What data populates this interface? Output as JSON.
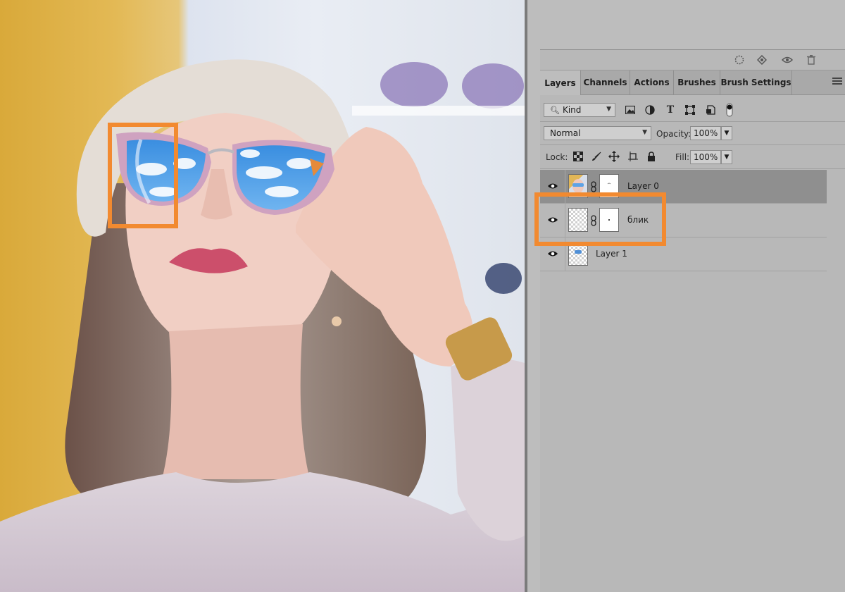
{
  "tabs": [
    {
      "label": "Layers",
      "active": true
    },
    {
      "label": "Channels",
      "active": false
    },
    {
      "label": "Actions",
      "active": false
    },
    {
      "label": "Brushes",
      "active": false
    },
    {
      "label": "Brush Settings",
      "active": false
    }
  ],
  "filter": {
    "kind_label": "Kind"
  },
  "blend": {
    "mode": "Normal",
    "opacity_label": "Opacity:",
    "opacity_value": "100%"
  },
  "lock": {
    "label": "Lock:",
    "fill_label": "Fill:",
    "fill_value": "100%"
  },
  "layers": [
    {
      "name": "Layer 0",
      "selected": true,
      "visible": true,
      "has_mask": true
    },
    {
      "name": "блик",
      "selected": false,
      "visible": true,
      "has_mask": true
    },
    {
      "name": "Layer 1",
      "selected": false,
      "visible": true,
      "has_mask": false
    }
  ],
  "colors": {
    "highlight": "#f28a30",
    "panel_bg": "#b8b8b8",
    "selected_row": "#8f8f8f"
  },
  "icons": [
    "selection-icon",
    "fill-icon",
    "visibility-icon",
    "trash-icon",
    "search-icon",
    "image-filter-icon",
    "adjustment-filter-icon",
    "type-filter-icon",
    "shape-filter-icon",
    "smart-object-filter-icon",
    "filter-toggle-icon",
    "lock-pixels-icon",
    "lock-brush-icon",
    "lock-position-icon",
    "lock-artboard-icon",
    "lock-all-icon",
    "eye-icon",
    "chain-link-icon",
    "panel-menu-icon"
  ]
}
